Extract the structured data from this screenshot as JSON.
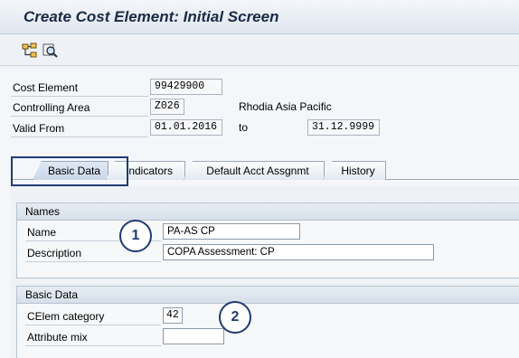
{
  "window": {
    "title": "Create Cost Element: Initial Screen"
  },
  "toolbar": {
    "icons": [
      "hierarchy-icon",
      "display-icon"
    ]
  },
  "header": {
    "cost_element_label": "Cost Element",
    "cost_element_value": "99429900",
    "controlling_area_label": "Controlling Area",
    "controlling_area_value": "Z026",
    "controlling_area_text": "Rhodia Asia Pacific",
    "valid_from_label": "Valid From",
    "valid_from_value": "01.01.2016",
    "to_label": "to",
    "valid_to_value": "31.12.9999"
  },
  "tabs": [
    {
      "label": "Basic Data",
      "active": true
    },
    {
      "label": "Indicators",
      "active": false
    },
    {
      "label": "Default Acct Assgnmt",
      "active": false
    },
    {
      "label": "History",
      "active": false
    }
  ],
  "names_group": {
    "title": "Names",
    "name_label": "Name",
    "name_value": "PA-AS CP",
    "description_label": "Description",
    "description_value": "COPA Assessment: CP"
  },
  "basic_group": {
    "title": "Basic Data",
    "celem_category_label": "CElem category",
    "celem_category_value": "42",
    "attribute_mix_label": "Attribute mix",
    "attribute_mix_value": ""
  },
  "callouts": [
    "1",
    "2"
  ],
  "colors": {
    "accent": "#1f3b73",
    "title_text": "#1a2a44"
  }
}
